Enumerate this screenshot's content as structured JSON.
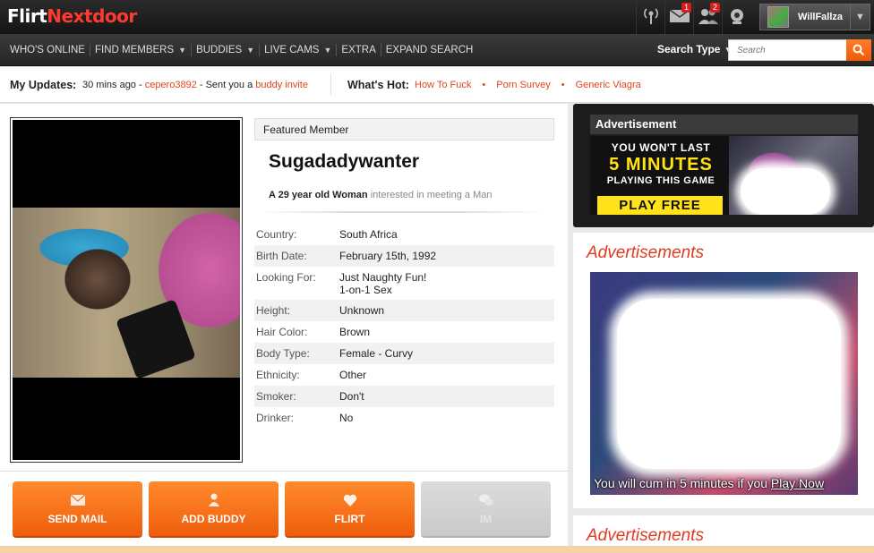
{
  "header": {
    "logo_part1": "Flirt",
    "logo_part2": "Ne",
    "logo_part3": "xtdoor",
    "icons": [
      {
        "name": "broadcast-icon",
        "badge": ""
      },
      {
        "name": "mail-icon",
        "badge": "1"
      },
      {
        "name": "buddies-icon",
        "badge": "2"
      },
      {
        "name": "webcam-icon",
        "badge": ""
      }
    ],
    "username": "WillFallza"
  },
  "nav": {
    "items": [
      {
        "label": "WHO'S ONLINE",
        "dropdown": false
      },
      {
        "label": "FIND MEMBERS",
        "dropdown": true
      },
      {
        "label": "BUDDIES",
        "dropdown": true
      },
      {
        "label": "LIVE CAMS",
        "dropdown": true
      },
      {
        "label": "EXTRA",
        "dropdown": false
      },
      {
        "label": "EXPAND SEARCH",
        "dropdown": false
      }
    ],
    "search_type_label": "Search Type",
    "search_placeholder": "Search"
  },
  "updates": {
    "label": "My Updates:",
    "time": "30 mins ago - ",
    "user": "cepero3892",
    "middle": " - Sent you a ",
    "link": "buddy invite",
    "hot_label": "What's Hot:",
    "hot_links": [
      "How To Fuck",
      "Porn Survey",
      "Generic Viagra"
    ]
  },
  "profile": {
    "featured_label": "Featured Member",
    "name": "Sugadadywanter",
    "subtitle_bold": "A 29 year old Woman",
    "subtitle_muted": "interested in meeting a Man",
    "details": [
      {
        "key": "Country:",
        "value": "South Africa",
        "value2": ""
      },
      {
        "key": "Birth Date:",
        "value": "February 15th, 1992",
        "value2": ""
      },
      {
        "key": "Looking For:",
        "value": "Just Naughty Fun!",
        "value2": "1-on-1 Sex"
      },
      {
        "key": "Height:",
        "value": "Unknown",
        "value2": ""
      },
      {
        "key": "Hair Color:",
        "value": "Brown",
        "value2": ""
      },
      {
        "key": "Body Type:",
        "value": "Female - Curvy",
        "value2": ""
      },
      {
        "key": "Ethnicity:",
        "value": "Other",
        "value2": ""
      },
      {
        "key": "Smoker:",
        "value": "Don't",
        "value2": ""
      },
      {
        "key": "Drinker:",
        "value": "No",
        "value2": ""
      }
    ],
    "actions": [
      {
        "label": "SEND MAIL",
        "icon": "envelope-icon",
        "disabled": false
      },
      {
        "label": "ADD BUDDY",
        "icon": "person-icon",
        "disabled": false
      },
      {
        "label": "FLIRT",
        "icon": "heart-icon",
        "disabled": false
      },
      {
        "label": "IM",
        "icon": "chat-icon",
        "disabled": true
      }
    ]
  },
  "ads": {
    "ad1_header": "Advertisement",
    "ad1_line1": "YOU WON'T LAST",
    "ad1_line2": "5 MINUTES",
    "ad1_line3": "PLAYING THIS GAME",
    "ad1_cta": "PLAY FREE",
    "ad2_title": "Advertisements",
    "ad2_caption_start": "You will cum in 5 minutes if you ",
    "ad2_caption_link": "Play Now",
    "ad3_title": "Advertisements"
  },
  "colors": {
    "accent_orange": "#ef5e0c",
    "link_red": "#e0461b",
    "ad_title_red": "#e03a20"
  }
}
